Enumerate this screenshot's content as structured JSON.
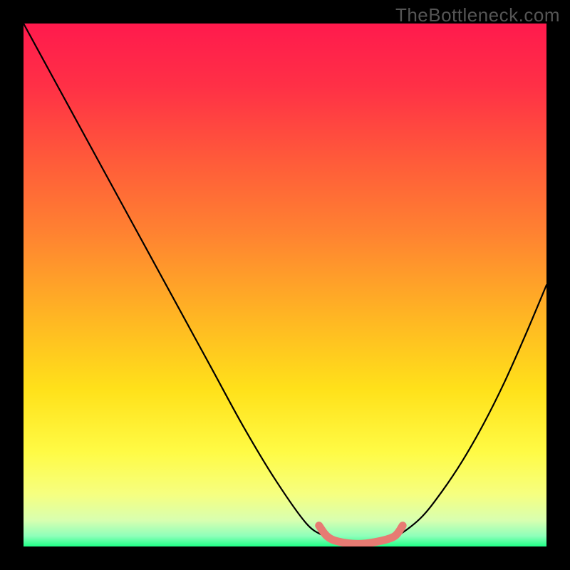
{
  "watermark": "TheBottleneck.com",
  "gradient_colors": {
    "c0": "#ff1a4d",
    "c1": "#ff3046",
    "c2": "#ff5a3a",
    "c3": "#ff8231",
    "c4": "#ffb224",
    "c5": "#ffe11a",
    "c6": "#fffb45",
    "c7": "#f6ff80",
    "c8": "#d8ffb0",
    "c9": "#8effba",
    "c10": "#1fff86"
  },
  "chart_data": {
    "type": "line",
    "title": "",
    "xlabel": "",
    "ylabel": "",
    "xlim": [
      0,
      1
    ],
    "ylim": [
      0,
      1
    ],
    "comment": "Two descending curves meeting a flat minimum segment (the salmon overlay). x is normalized horizontal position across the plot; y is normalized bottleneck/mismatch (0 = bottom/green, 1 = top/red).",
    "series": [
      {
        "name": "left-curve",
        "x": [
          0.0,
          0.06,
          0.12,
          0.18,
          0.24,
          0.3,
          0.36,
          0.42,
          0.48,
          0.54,
          0.575
        ],
        "y": [
          1.0,
          0.89,
          0.78,
          0.67,
          0.56,
          0.45,
          0.34,
          0.23,
          0.13,
          0.045,
          0.02
        ]
      },
      {
        "name": "flat-minimum",
        "x": [
          0.575,
          0.6,
          0.63,
          0.66,
          0.69,
          0.715
        ],
        "y": [
          0.02,
          0.01,
          0.005,
          0.005,
          0.01,
          0.02
        ]
      },
      {
        "name": "right-curve",
        "x": [
          0.715,
          0.76,
          0.8,
          0.84,
          0.88,
          0.92,
          0.96,
          1.0
        ],
        "y": [
          0.02,
          0.055,
          0.105,
          0.165,
          0.235,
          0.315,
          0.405,
          0.5
        ]
      },
      {
        "name": "highlight-overlay",
        "x": [
          0.565,
          0.58,
          0.6,
          0.64,
          0.68,
          0.71,
          0.725
        ],
        "y": [
          0.04,
          0.02,
          0.01,
          0.005,
          0.01,
          0.02,
          0.04
        ]
      }
    ],
    "highlight_color": "#e77b73",
    "curve_color": "#000000"
  }
}
